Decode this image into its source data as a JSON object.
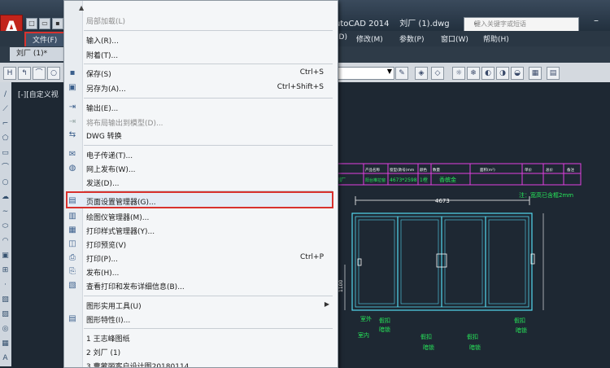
{
  "title_bar": {
    "title": "utoCAD 2014    刘厂 (1).dwg",
    "search_placeholder": "键入关键字或短语",
    "logo": "A"
  },
  "menubar": {
    "file": "文件(F)",
    "items": [
      "(D)",
      "修改(M)",
      "参数(P)",
      "窗口(W)",
      "帮助(H)"
    ]
  },
  "tab": {
    "label": "刘厂 (1)*"
  },
  "viewport_label": "[-][自定义视",
  "file_menu": {
    "recent_load": "局部加载(L)",
    "import": "输入(R)...",
    "attach": "附着(T)...",
    "save": "保存(S)",
    "save_shortcut": "Ctrl+S",
    "save_as": "另存为(A)...",
    "save_as_shortcut": "Ctrl+Shift+S",
    "export": "输出(E)...",
    "export_layout": "将布局输出到模型(D)...",
    "dwg_convert": "DWG 转换",
    "etransmit": "电子传递(T)...",
    "publish_web": "网上发布(W)...",
    "send": "发送(D)...",
    "page_setup": "页面设置管理器(G)...",
    "plotter_manager": "绘图仪管理器(M)...",
    "plot_style_manager": "打印样式管理器(Y)...",
    "plot_preview": "打印预览(V)",
    "plot": "打印(P)...",
    "plot_shortcut": "Ctrl+P",
    "publish": "发布(H)...",
    "view_plot_details": "查看打印和发布详细信息(B)...",
    "drawing_utilities": "图形实用工具(U)",
    "drawing_properties": "图形特性(I)...",
    "recent_1": "1 王志峰图纸",
    "recent_2": "2 刘厂 (1)",
    "recent_3": "3 曹蒙丽客户设计图20180114"
  },
  "drawing": {
    "width_dim": "4673",
    "note": "注：宽高已含框2mm",
    "dim_1100": "1100",
    "header_cells": [
      "产品名称",
      "窗型(款号)mm",
      "颜色",
      "数量",
      "面积(m²)",
      "单价",
      "总价",
      "备注"
    ],
    "row_cells": [
      "刘厂",
      "阳台推拉窗",
      "4673*2598",
      "1樘",
      "香槟金"
    ],
    "labels": {
      "outside": "室外",
      "inside": "室内",
      "slide_lock": "假扣",
      "dark_lock": "暗锁",
      "slide_lock_2": "假扣",
      "dark_lock_2": "暗锁",
      "slide_lock_3": "假扣",
      "dark_lock_3": "暗锁",
      "slide_lock_4": "假扣",
      "dark_lock_4": "暗锁"
    }
  },
  "colors": {
    "highlight_border": "#d8322e",
    "drawing_green": "#27e85a",
    "drawing_cyan": "#53d8f0",
    "drawing_magenta": "#e23fe0"
  }
}
